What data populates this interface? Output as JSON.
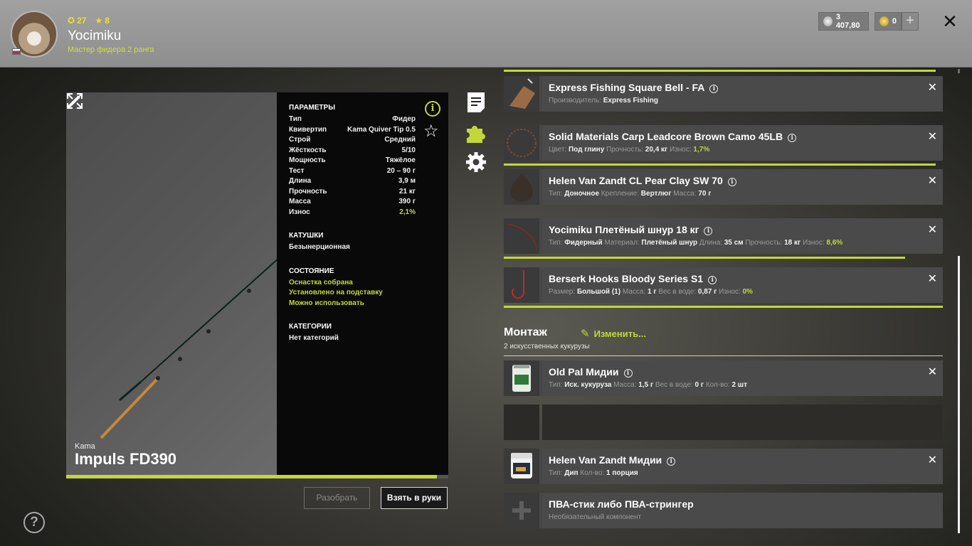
{
  "header": {
    "stat_coins": "27",
    "stat_stars": "8",
    "username": "Yocimiku",
    "rank": "Мастер фидера 2 ранга",
    "silver": "3 407,80",
    "gold": "0"
  },
  "rod": {
    "brand": "Kama",
    "model": "Impuls FD390",
    "condition_fill": 0.97
  },
  "params": {
    "title": "ПАРАМЕТРЫ",
    "rows": [
      {
        "label": "Тип",
        "value": "Фидер"
      },
      {
        "label": "Квивертип",
        "value": "Kama Quiver Tip 0.5"
      },
      {
        "label": "Строй",
        "value": "Средний"
      },
      {
        "label": "Жёсткость",
        "value": "5/10"
      },
      {
        "label": "Мощность",
        "value": "Тяжёлое"
      },
      {
        "label": "Тест",
        "value": "20 – 90 г"
      },
      {
        "label": "Длина",
        "value": "3,9 м"
      },
      {
        "label": "Прочность",
        "value": "21 кг"
      },
      {
        "label": "Масса",
        "value": "390 г"
      },
      {
        "label": "Износ",
        "value": "2,1%"
      }
    ],
    "reels_title": "КАТУШКИ",
    "reels_value": "Безынерционная",
    "state_title": "СОСТОЯНИЕ",
    "state_lines": [
      "Оснастка собрана",
      "Установлено на подставку",
      "Можно использовать"
    ],
    "categories_title": "КАТЕГОРИИ",
    "categories_value": "Нет категорий"
  },
  "buttons": {
    "disassemble": "Разобрать",
    "take": "Взять в руки"
  },
  "items": [
    {
      "name": "Express Fishing Square Bell - FA",
      "props": [
        [
          "Производитель:",
          "Express Fishing"
        ]
      ]
    },
    {
      "name": "Solid Materials Carp Leadcore Brown Camo 45LB",
      "props": [
        [
          "Цвет:",
          "Под глину"
        ],
        [
          "Прочность:",
          "20,4 кг"
        ],
        [
          "Износ:",
          "1,7%"
        ]
      ]
    },
    {
      "name": "Helen Van Zandt CL Pear Clay SW 70",
      "props": [
        [
          "Тип:",
          "Доночное"
        ],
        [
          "Крепление:",
          "Вертлюг"
        ],
        [
          "Масса:",
          "70 г"
        ]
      ]
    },
    {
      "name": "Yocimiku Плетёный шнур 18 кг",
      "props": [
        [
          "Тип:",
          "Фидерный"
        ],
        [
          "Материал:",
          "Плетёный шнур"
        ],
        [
          "Длина:",
          "35 см"
        ],
        [
          "Прочность:",
          "18 кг"
        ],
        [
          "Износ:",
          "8,6%"
        ]
      ]
    },
    {
      "name": "Berserk Hooks Bloody Series S1",
      "props": [
        [
          "Размер:",
          "Большой (1)"
        ],
        [
          "Масса:",
          "1 г"
        ],
        [
          "Вес в воде:",
          "0,87 г"
        ],
        [
          "Износ:",
          "0%"
        ]
      ]
    }
  ],
  "mount": {
    "title": "Монтаж",
    "edit": "Изменить...",
    "subtitle": "2 искусственных кукурузы",
    "items": [
      {
        "name": "Old Pal Мидии",
        "props": [
          [
            "Тип:",
            "Иск. кукуруза"
          ],
          [
            "Масса:",
            "1,5 г"
          ],
          [
            "Вес в воде:",
            "0 г"
          ],
          [
            "Кол-во:",
            "2 шт"
          ]
        ]
      },
      {
        "name": "Helen Van Zandt Мидии",
        "props": [
          [
            "Тип:",
            "Дип"
          ],
          [
            "Кол-во:",
            "1 порция"
          ]
        ]
      },
      {
        "name": "ПВА-стик либо ПВА-стрингер",
        "props": [
          [
            "Необязательный компонент",
            ""
          ]
        ]
      }
    ]
  },
  "colors": {
    "accent": "#c2d83a",
    "panel": "#090909",
    "header": "#9a9a9a"
  },
  "icons": [
    "info-icon",
    "star-icon",
    "document-icon",
    "puzzle-icon",
    "gear-icon",
    "expand-icon",
    "wand-icon",
    "help-icon",
    "close-icon",
    "plus-icon",
    "coin-icon"
  ]
}
